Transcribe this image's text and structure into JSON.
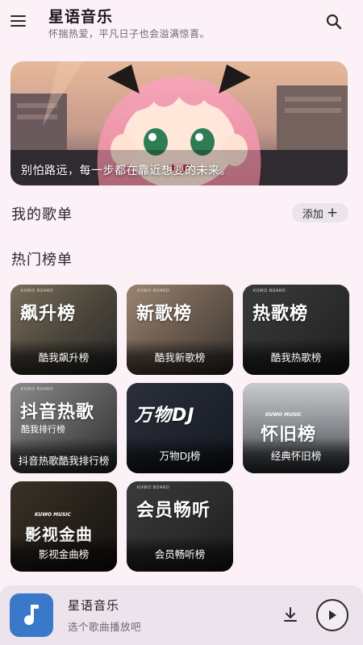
{
  "header": {
    "title": "星语音乐",
    "subtitle": "怀揣热爱，平凡日子也会溢满惊喜。",
    "menu_icon": "menu-icon",
    "search_icon": "search-icon"
  },
  "banner": {
    "caption": "别怕路远，每一步都在靠近想要的未来。"
  },
  "my_playlists": {
    "title": "我的歌单",
    "add_label": "添加",
    "add_icon": "plus-icon"
  },
  "hot_charts": {
    "title": "热门榜单",
    "cards": [
      {
        "cover_text": "飙升榜",
        "label": "酷我飙升榜"
      },
      {
        "cover_text": "新歌榜",
        "label": "酷我新歌榜"
      },
      {
        "cover_text": "热歌榜",
        "label": "酷我热歌榜"
      },
      {
        "cover_text": "抖音热歌",
        "cover_subtext": "酷我排行榜",
        "label": "抖音热歌酷我排行榜"
      },
      {
        "cover_text": "万物DJ",
        "label": "万物DJ榜"
      },
      {
        "cover_text": "怀旧榜",
        "cover_logo": "KUWO MUSIC",
        "label": "经典怀旧榜"
      },
      {
        "cover_text": "影视金曲",
        "cover_logo": "KUWO MUSIC",
        "label": "影视金曲榜"
      },
      {
        "cover_text": "会员畅听",
        "label": "会员畅听榜"
      }
    ],
    "brand_mark": "KUWO BOARD"
  },
  "player": {
    "title": "星语音乐",
    "subtitle": "选个歌曲播放吧",
    "album_icon": "music-note-icon",
    "download_icon": "download-icon",
    "play_icon": "play-icon"
  },
  "colors": {
    "background": "#fbf1f7",
    "player_bg": "#ece3ec",
    "album_blue": "#3a78c9"
  }
}
